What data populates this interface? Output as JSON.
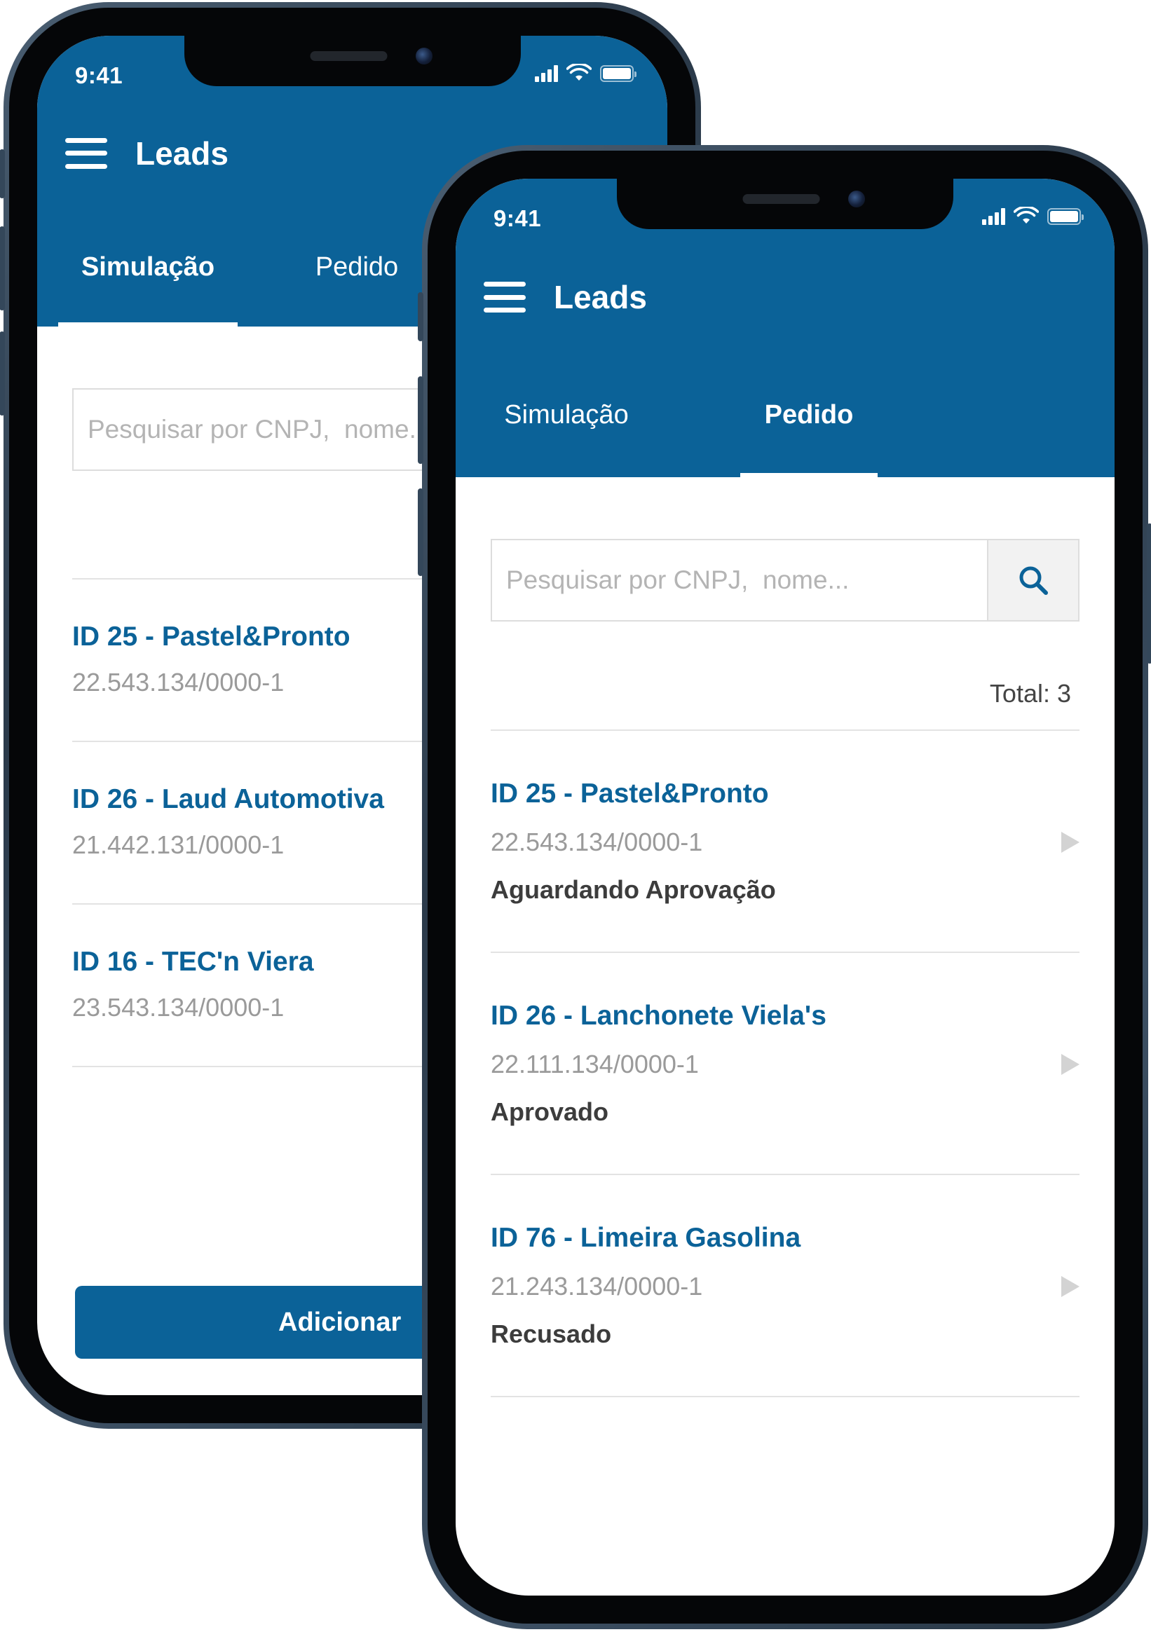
{
  "back_phone": {
    "status_time": "9:41",
    "title": "Leads",
    "tabs": [
      {
        "label": "Simulação",
        "active": true
      },
      {
        "label": "Pedido",
        "active": false
      }
    ],
    "search": {
      "placeholder": "Pesquisar por CNPJ,  nome..."
    },
    "items": [
      {
        "title": "ID 25 - Pastel&Pronto",
        "cnpj": "22.543.134/0000-1"
      },
      {
        "title": "ID 26 - Laud Automotiva",
        "cnpj": "21.442.131/0000-1"
      },
      {
        "title": "ID 16 - TEC'n Viera",
        "cnpj": "23.543.134/0000-1"
      }
    ],
    "add_button_label": "Adicionar"
  },
  "front_phone": {
    "status_time": "9:41",
    "title": "Leads",
    "tabs": [
      {
        "label": "Simulação",
        "active": false
      },
      {
        "label": "Pedido",
        "active": true
      }
    ],
    "search": {
      "placeholder": "Pesquisar por CNPJ,  nome..."
    },
    "total_label": "Total: 3",
    "items": [
      {
        "title": "ID 25 - Pastel&Pronto",
        "cnpj": "22.543.134/0000-1",
        "status": "Aguardando Aprovação"
      },
      {
        "title": "ID 26 - Lanchonete Viela's",
        "cnpj": "22.111.134/0000-1",
        "status": "Aprovado"
      },
      {
        "title": "ID 76 - Limeira Gasolina",
        "cnpj": "21.243.134/0000-1",
        "status": "Recusado"
      }
    ]
  },
  "icons": {
    "menu": "hamburger-icon",
    "search": "search-icon",
    "chevron": "chevron-right-icon",
    "signal": "signal-icon",
    "wifi": "wifi-icon",
    "battery": "battery-icon"
  },
  "colors": {
    "primary": "#0b6298",
    "title_text": "#0b6298",
    "muted_text": "#9a9a9a",
    "divider": "#e3e3e3"
  }
}
